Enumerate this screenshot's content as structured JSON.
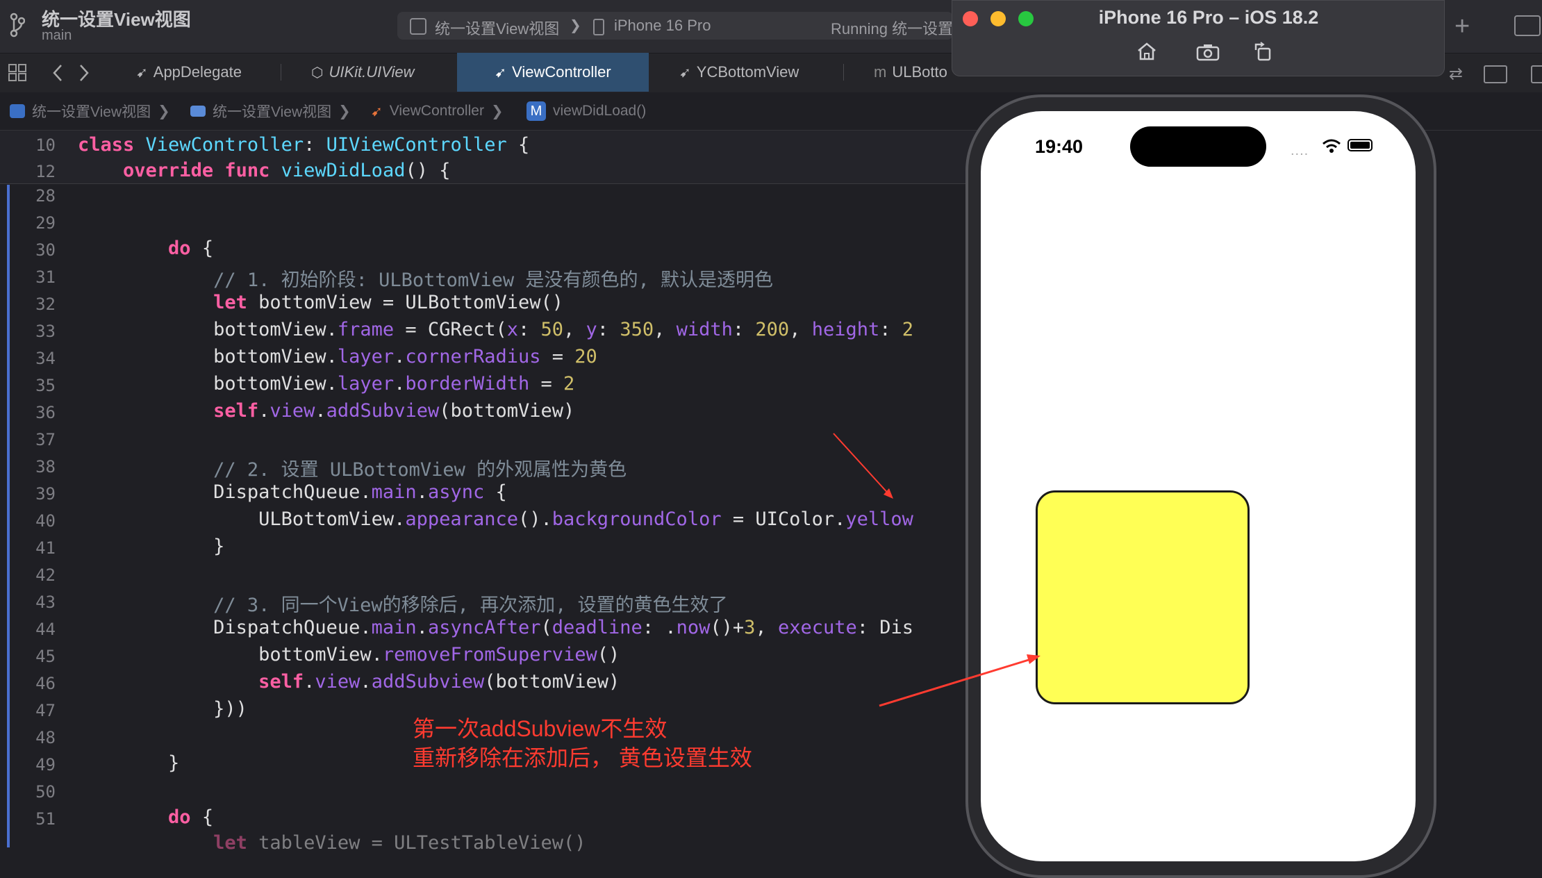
{
  "titlebar": {
    "project": "统一设置View视图",
    "branch": "main",
    "scheme": "统一设置View视图",
    "scheme_sep": "❯",
    "device": "iPhone 16 Pro",
    "status": "Running 统一设置"
  },
  "tabs": [
    {
      "label": "AppDelegate"
    },
    {
      "label": "UIKit.UIView"
    },
    {
      "label": "ViewController"
    },
    {
      "label": "YCBottomView"
    },
    {
      "label": "ULBotto"
    }
  ],
  "breadcrumb": [
    "统一设置View视图",
    "统一设置View视图",
    "ViewController",
    "viewDidLoad()"
  ],
  "breadcrumb_sep": "❯",
  "breadcrumb_method_badge": "M",
  "sticky": [
    {
      "ln": "10"
    },
    {
      "ln": "12"
    }
  ],
  "code_lines": [
    "28",
    "29",
    "30",
    "31",
    "32",
    "33",
    "34",
    "35",
    "36",
    "37",
    "38",
    "39",
    "40",
    "41",
    "42",
    "43",
    "44",
    "45",
    "46",
    "47",
    "48",
    "49",
    "50",
    "51"
  ],
  "annotation": {
    "line1": "第一次addSubview不生效",
    "line2": "重新移除在添加后， 黄色设置生效"
  },
  "simulator": {
    "title": "iPhone 16 Pro – iOS 18.2",
    "time": "19:40"
  },
  "colors": {
    "yellow_box": "#ffff55",
    "annotation_red": "#ff3b30",
    "active_tab": "#2f4f70"
  },
  "icons": [
    "branch-icon",
    "grid-icon",
    "back-icon",
    "forward-icon",
    "swift-file-icon",
    "home-icon",
    "screenshot-icon",
    "rotate-icon",
    "wifi-icon",
    "battery-icon",
    "add-icon",
    "inspector-icon"
  ]
}
